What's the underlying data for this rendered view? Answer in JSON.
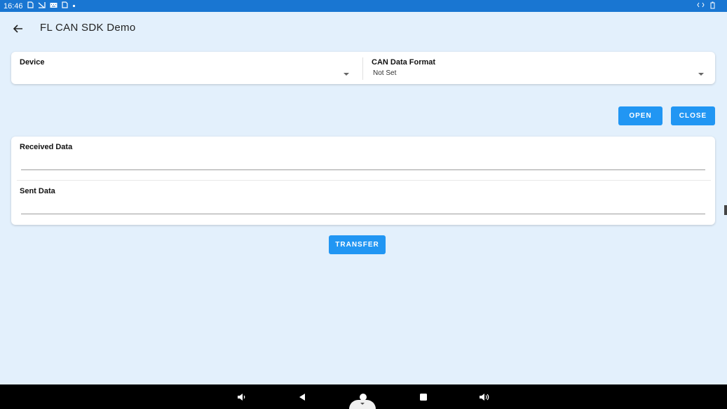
{
  "status_bar": {
    "time": "16:46",
    "icons_left": [
      "sim-icon",
      "signal-off-icon",
      "keyboard-icon",
      "sim-icon",
      "dot-icon"
    ],
    "icons_right": [
      "ethernet-icon",
      "battery-icon"
    ]
  },
  "app_bar": {
    "title": "FL CAN SDK Demo",
    "back_icon": "arrow-left-icon"
  },
  "settings": {
    "device": {
      "label": "Device",
      "value": ""
    },
    "can_format": {
      "label": "CAN Data Format",
      "value": "Not Set"
    }
  },
  "actions": {
    "open_label": "OPEN",
    "close_label": "CLOSE",
    "transfer_label": "TRANSFER"
  },
  "data": {
    "received": {
      "label": "Received Data",
      "value": ""
    },
    "sent": {
      "label": "Sent Data",
      "value": ""
    }
  },
  "colors": {
    "status_bar": "#1976d2",
    "background": "#e3f0fc",
    "button": "#2196f3",
    "nav_bar": "#000000"
  }
}
